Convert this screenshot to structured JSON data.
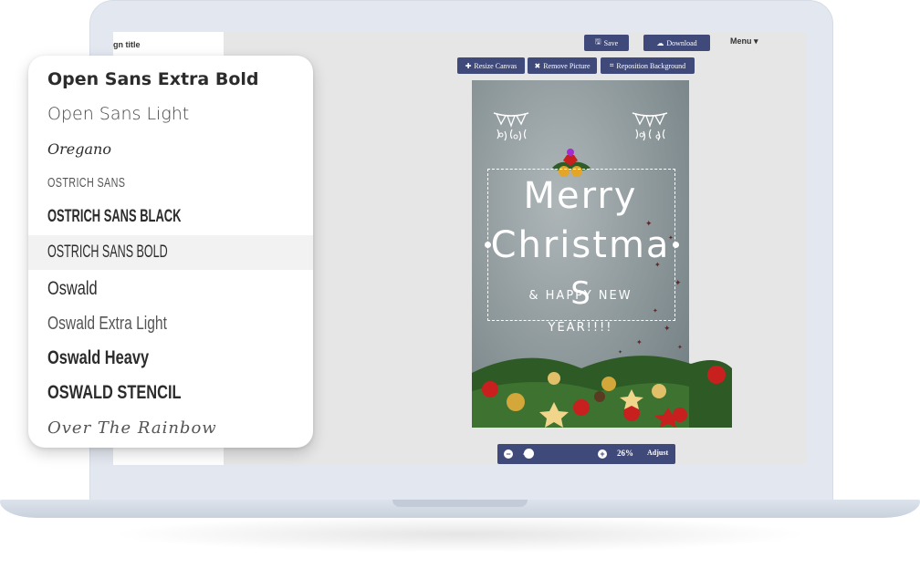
{
  "app": {
    "design_title": "gn title",
    "menu_label": "Menu ▾"
  },
  "toolbar": {
    "save_label": "Save",
    "download_label": "Download"
  },
  "canvas_toolbar": {
    "resize_label": "Resize Canvas",
    "remove_picture_label": "Remove Picture",
    "reposition_background_label": "Reposition Background"
  },
  "card": {
    "line1": "Merry",
    "line2": "Christma",
    "line2_overflow": "S",
    "line3": "& HAPPY NEW",
    "line4": "YEAR!!!!",
    "background_color": "#8b9699"
  },
  "zoom": {
    "percent": "26%",
    "adjust_label": "Adjust",
    "level": 0.26
  },
  "font_list": {
    "items": [
      {
        "label": "Open Sans Extra Bold",
        "highlighted": false
      },
      {
        "label": "Open Sans Light",
        "highlighted": false
      },
      {
        "label": "Oregano",
        "highlighted": false
      },
      {
        "label": "OSTRICH SANS",
        "highlighted": false
      },
      {
        "label": "OSTRICH SANS BLACK",
        "highlighted": false
      },
      {
        "label": "OSTRICH SANS BOLD",
        "highlighted": true
      },
      {
        "label": "Oswald",
        "highlighted": false
      },
      {
        "label": "Oswald Extra Light",
        "highlighted": false
      },
      {
        "label": "Oswald Heavy",
        "highlighted": false
      },
      {
        "label": "OSWALD STENCIL",
        "highlighted": false
      },
      {
        "label": "Over The Rainbow",
        "highlighted": false
      }
    ]
  },
  "colors": {
    "accent": "#3f4a7a",
    "screen_bg": "#e6e6e6",
    "laptop": "#e3e8f0"
  }
}
